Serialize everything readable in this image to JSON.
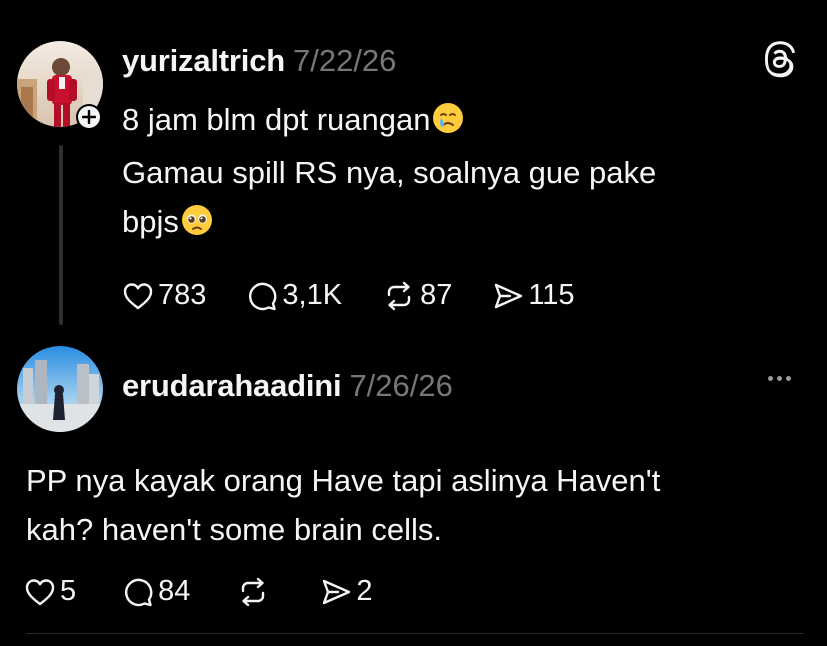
{
  "post": {
    "username": "yurizaltrich",
    "date": "7/22/26",
    "text_line1": "8 jam blm dpt ruangan",
    "text_line2": "Gamau spill RS nya, soalnya gue pake",
    "text_line3": "bpjs",
    "emoji1": "crying-face-emoji",
    "emoji2": "pleading-face-emoji",
    "likes": "783",
    "replies": "3,1K",
    "reposts": "87",
    "shares": "115"
  },
  "reply": {
    "username": "erudarahaadini",
    "date": "7/26/26",
    "text_line1": "PP nya kayak orang Have tapi aslinya Haven't",
    "text_line2": "kah? haven't some brain cells.",
    "likes": "5",
    "replies": "84",
    "shares": "2"
  },
  "icons": {
    "threads_logo": "threads-logo-icon",
    "follow": "plus-icon",
    "like": "heart-icon",
    "reply": "comment-icon",
    "repost": "repost-icon",
    "share": "send-icon",
    "more": "more-dots-icon"
  },
  "colors": {
    "background": "#000000",
    "text": "#f3f5f7",
    "secondary": "#777777",
    "thread_line": "#2f2f2f"
  }
}
